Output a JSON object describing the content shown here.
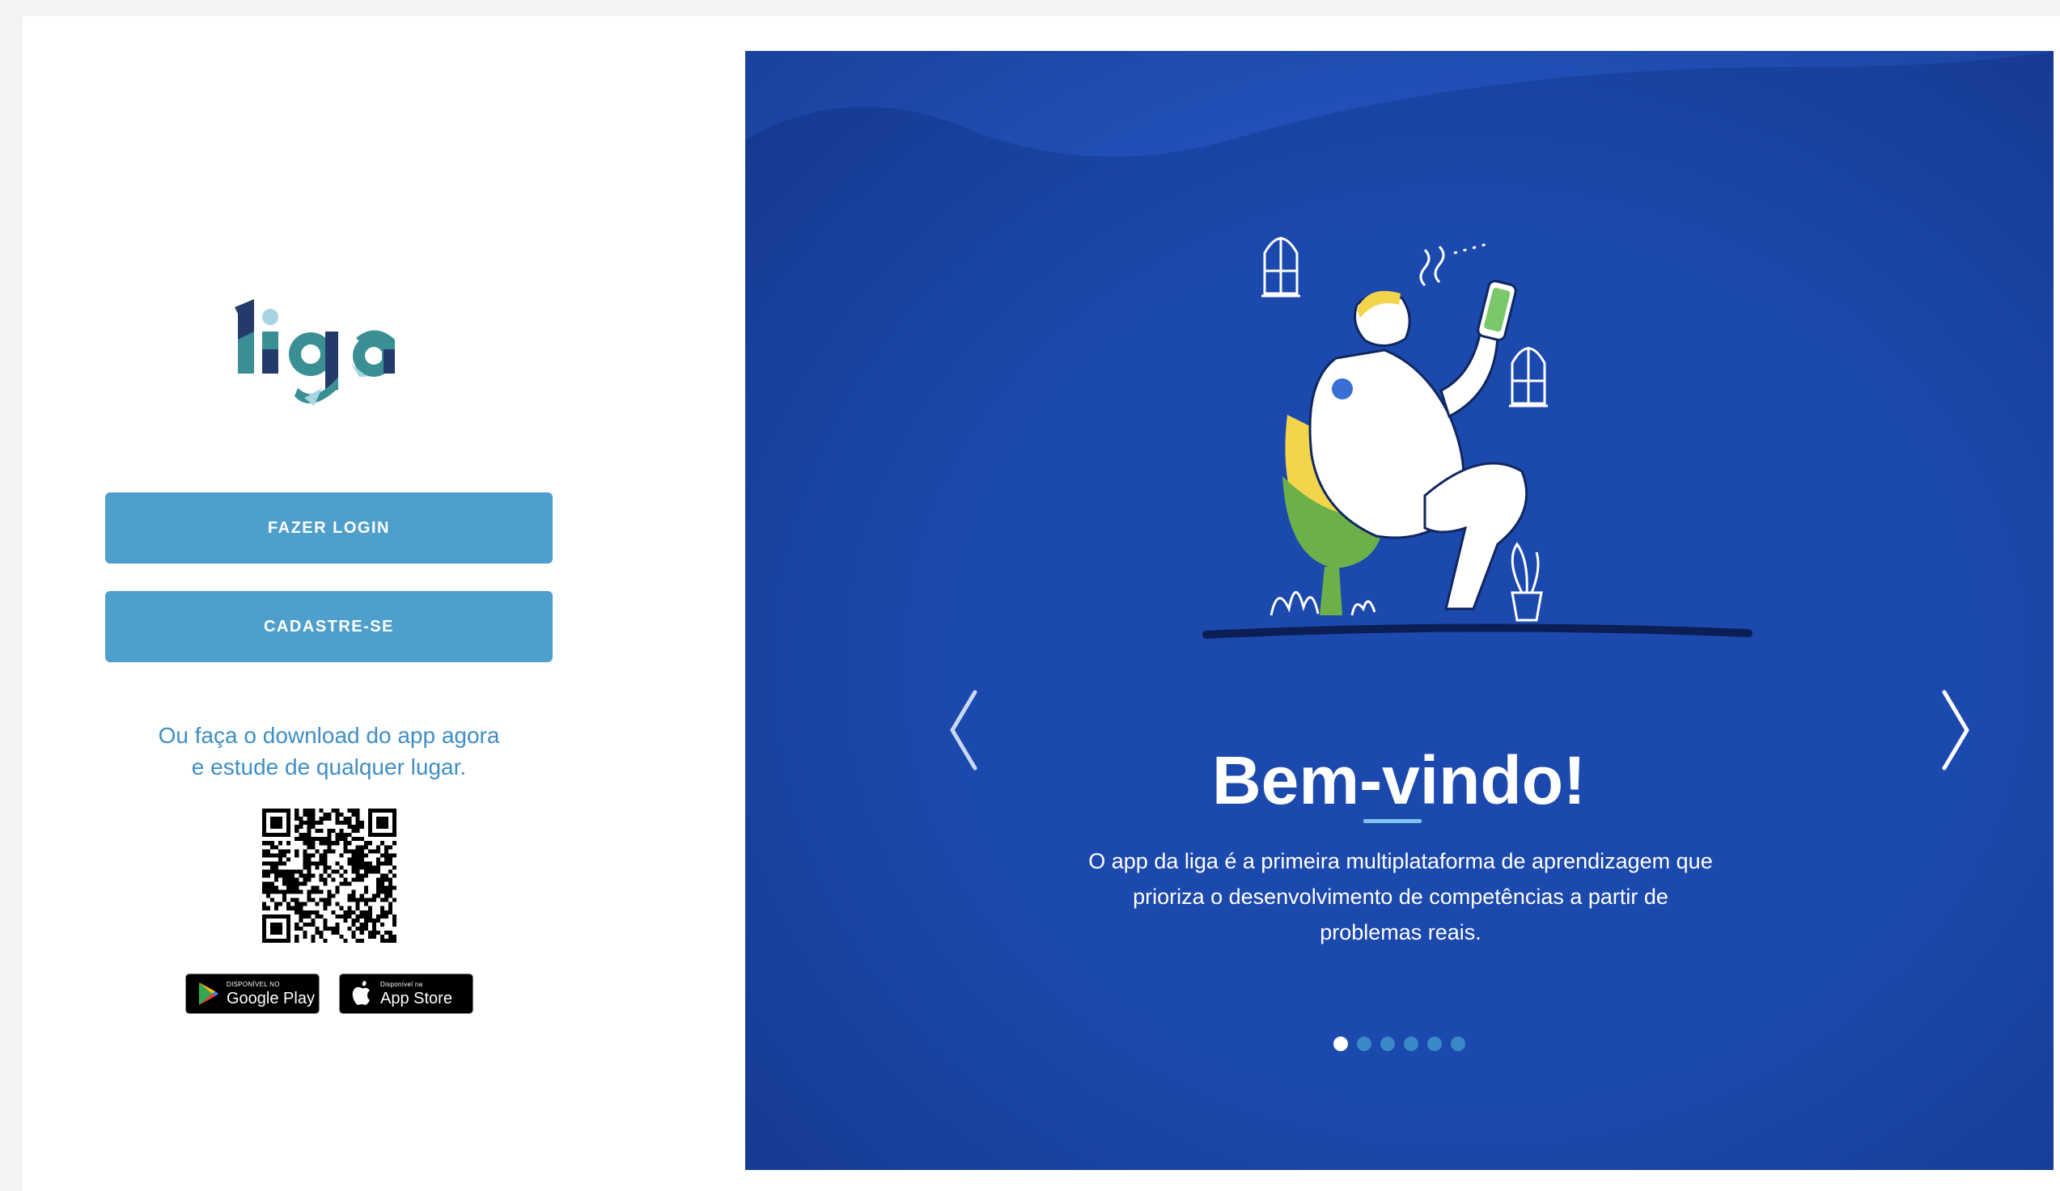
{
  "brand": {
    "logo_text": "liga",
    "colors": {
      "teal": "#3a8f94",
      "navy": "#243a6a",
      "light": "#a7d4e2"
    }
  },
  "auth": {
    "login_label": "FAZER LOGIN",
    "signup_label": "CADASTRE-SE",
    "button_color": "#4f9fcc"
  },
  "download": {
    "line1": "Ou faça o download do app agora",
    "line2": "e estude de qualquer lugar.",
    "google_play": {
      "small": "DISPONÍVEL NO",
      "big": "Google Play"
    },
    "app_store": {
      "small": "Disponível na",
      "big": "App Store"
    }
  },
  "carousel": {
    "background": "#1c49ad",
    "title": "Bem-vindo!",
    "description": "O app da liga é a primeira multiplataforma de aprendizagem que prioriza o desenvolvimento de competências a partir de problemas reais.",
    "slide_count": 6,
    "active_index": 0,
    "prev_icon": "chevron-left-icon",
    "next_icon": "chevron-right-icon"
  }
}
